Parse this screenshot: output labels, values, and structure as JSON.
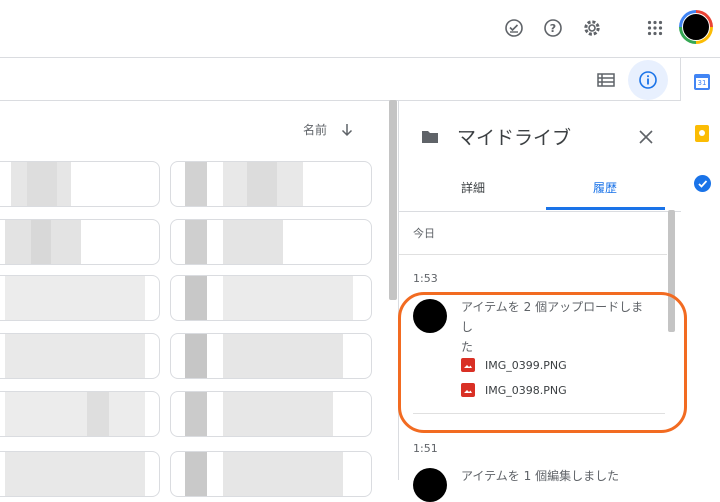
{
  "topbar": {
    "icons": [
      "task-check-icon",
      "help-icon",
      "settings-icon",
      "apps-grid-icon"
    ]
  },
  "toolbar": {
    "icons": [
      "list-view-icon",
      "info-icon"
    ]
  },
  "files": {
    "sort_label": "名前",
    "sort_icon": "arrow-down-icon"
  },
  "details_panel": {
    "title": "マイドライブ",
    "tabs": [
      {
        "label": "詳細",
        "active": false
      },
      {
        "label": "履歴",
        "active": true
      }
    ],
    "sections": [
      {
        "label": "今日"
      }
    ],
    "activities": [
      {
        "time": "1:53",
        "text_line1": "アイテムを 2 個アップロードしまし",
        "text_line2": "た",
        "files": [
          "IMG_0399.PNG",
          "IMG_0398.PNG"
        ]
      },
      {
        "time": "1:51",
        "text_line1": "アイテムを 1 個編集しました"
      }
    ]
  },
  "side_apps": [
    "calendar-icon",
    "keep-icon",
    "tasks-icon"
  ],
  "colors": {
    "accent": "#1a73e8",
    "highlight": "#f26b21",
    "file_icon": "#d93025"
  }
}
